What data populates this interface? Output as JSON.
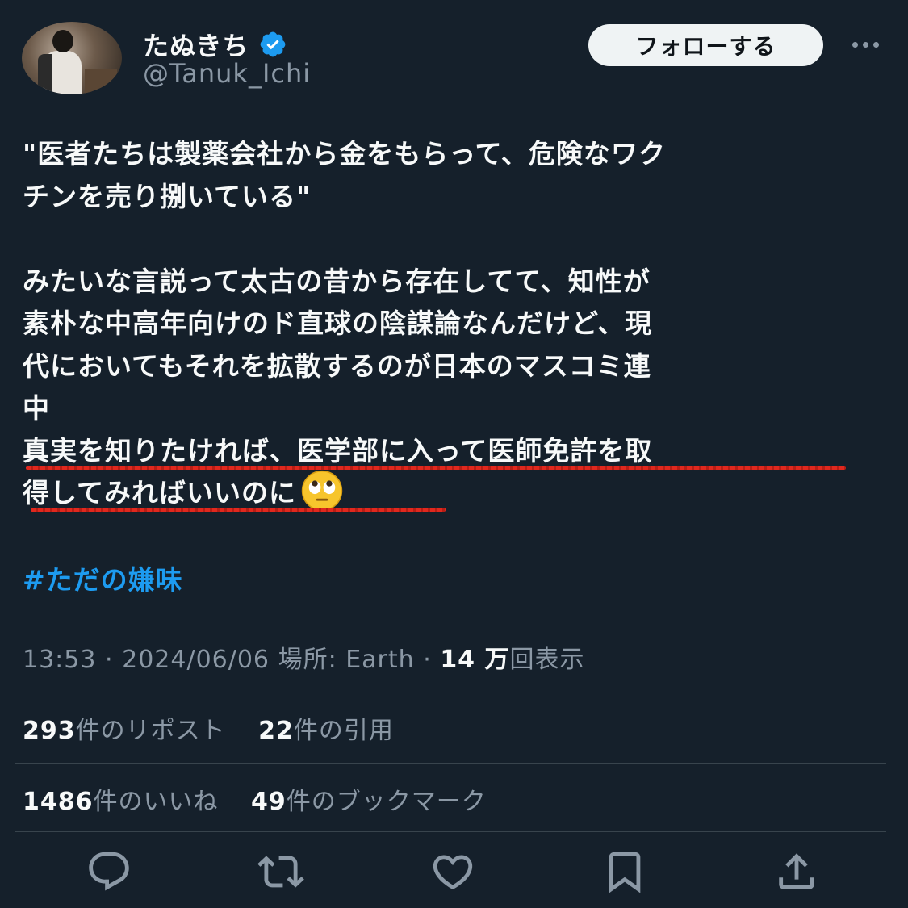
{
  "author": {
    "display_name": "たぬきち",
    "handle": "@Tanuk_Ichi",
    "verified": true
  },
  "header": {
    "follow_label": "フォローする",
    "more_icon": "more-horizontal-icon"
  },
  "tweet": {
    "lines": [
      "\"医者たちは製薬会社から金をもらって、危険なワク",
      "チンを売り捌いている\"",
      "",
      "みたいな言説って太古の昔から存在してて、知性が",
      "素朴な中高年向けのド直球の陰謀論なんだけど、現",
      "代においてもそれを拡散するのが日本のマスコミ連",
      "中"
    ],
    "underlined_lines": [
      "真実を知りたければ、医学部に入って医師免許を取",
      "得してみればいいのに"
    ],
    "emoji": "face-with-rolling-eyes",
    "hashtag": "#ただの嫌味"
  },
  "meta": {
    "time": "13:53",
    "separator": "·",
    "date": "2024/06/06",
    "location_label": "場所: Earth",
    "views_count": "14 万",
    "views_label": "回表示"
  },
  "stats": {
    "reposts_count": "293",
    "reposts_label": "件のリポスト",
    "quotes_count": "22",
    "quotes_label": "件の引用",
    "likes_count": "1486",
    "likes_label": "件のいいね",
    "bookmarks_count": "49",
    "bookmarks_label": "件のブックマーク"
  },
  "colors": {
    "background": "#15202b",
    "text": "#f7f9f9",
    "secondary": "#8b98a5",
    "accent": "#1d9bf0",
    "underline": "#e0281e"
  },
  "actions": [
    "reply-icon",
    "repost-icon",
    "like-icon",
    "bookmark-icon",
    "share-icon"
  ]
}
